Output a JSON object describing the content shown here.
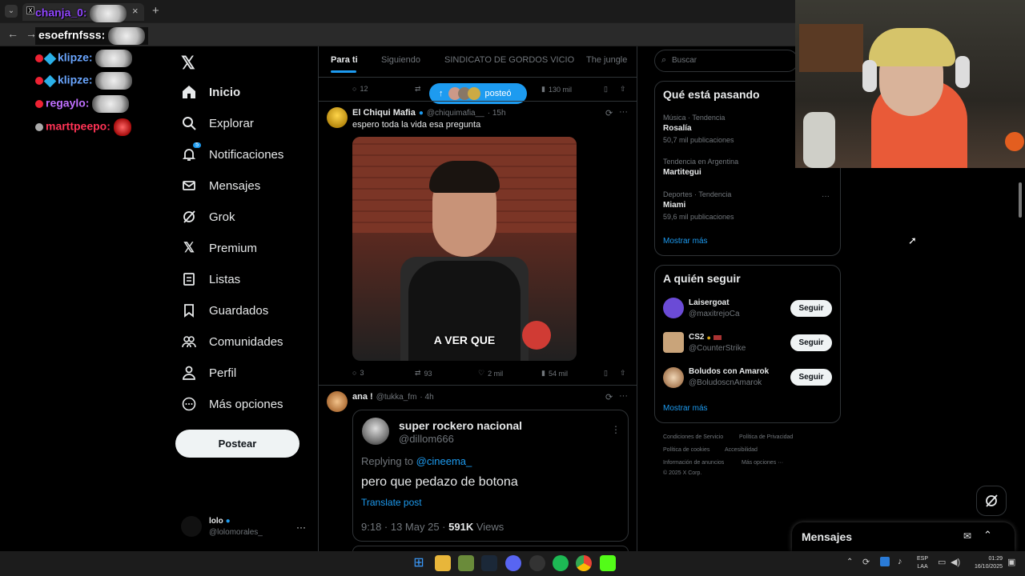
{
  "browser": {
    "tab_title": "",
    "close": "×",
    "new_tab": "+"
  },
  "chat": [
    {
      "user": "chanja_0:",
      "color": "#9146ff"
    },
    {
      "user": "esoefrnfsss:",
      "color": "#e7e9ea"
    },
    {
      "user": "klipze:",
      "color": "#6aa6ff"
    },
    {
      "user": "klipze:",
      "color": "#6aa6ff"
    },
    {
      "user": "regaylo:",
      "color": "#c070ff"
    },
    {
      "user": "marttpeepo:",
      "color": "#ff3355"
    }
  ],
  "nav": {
    "items": [
      "Inicio",
      "Explorar",
      "Notificaciones",
      "Mensajes",
      "Grok",
      "Premium",
      "Listas",
      "Guardados",
      "Comunidades",
      "Perfil",
      "Más opciones"
    ],
    "notif_count": "5",
    "post_button": "Postear",
    "account_name": "lolo",
    "account_handle": "@lolomorales_",
    "more": "···"
  },
  "feed": {
    "tabs": [
      "Para ti",
      "Siguiendo",
      "SINDICATO DE GORDOS VICIO",
      "The jungle"
    ],
    "top_stats": {
      "replies": "12",
      "views": "130 mil"
    },
    "posted_pill": "posteó",
    "post1": {
      "name": "El Chiqui Mafia",
      "handle": "@chiquimafia__",
      "time": "· 15h",
      "text": "espero toda la vida esa pregunta",
      "caption": "A VER QUE",
      "replies": "3",
      "reposts": "93",
      "likes": "2 mil",
      "views": "54 mil"
    },
    "post2": {
      "name": "ana !",
      "handle": "@tukka_fm",
      "time": "· 4h",
      "quoted_name": "super rockero nacional",
      "quoted_handle": "@dillom666",
      "replying_prefix": "Replying to",
      "replying_to": "@cineema_",
      "quoted_text": "pero que pedazo de botona",
      "translate": "Translate post",
      "meta_time": "9:18 · 13 May 25 ·",
      "meta_views": "591K",
      "meta_views_label": "Views"
    }
  },
  "right": {
    "search_placeholder": "Buscar",
    "trends_title": "Qué está pasando",
    "trends": [
      {
        "cat": "Música · Tendencia",
        "name": "Rosalía",
        "count": "50,7 mil publicaciones"
      },
      {
        "cat": "Tendencia en Argentina",
        "name": "Martitegui",
        "count": ""
      },
      {
        "cat": "Deportes · Tendencia",
        "name": "Miami",
        "count": "59,6 mil publicaciones"
      }
    ],
    "show_more": "Mostrar más",
    "follow_title": "A quién seguir",
    "follow": [
      {
        "name": "Laisergoat",
        "handle": "@maxitrejoCa",
        "color": "#6b4bd6"
      },
      {
        "name": "CS2",
        "handle": "@CounterStrike",
        "color": "#c9a47a"
      },
      {
        "name": "Boludos con Amarok",
        "handle": "@BoludoscnAmarok",
        "color": "#ddd"
      }
    ],
    "follow_btn": "Seguir",
    "show_more2": "Mostrar más",
    "footer": [
      "Condiciones de Servicio",
      "Política de Privacidad",
      "Política de cookies",
      "Accesibilidad",
      "Información de anuncios",
      "Más opciones ···",
      "© 2025 X Corp."
    ]
  },
  "messages_bar": {
    "title": "Mensajes"
  },
  "taskbar": {
    "lang": "ESP",
    "lang2": "LAA",
    "time": "01:29",
    "date": "16/10/2025"
  }
}
